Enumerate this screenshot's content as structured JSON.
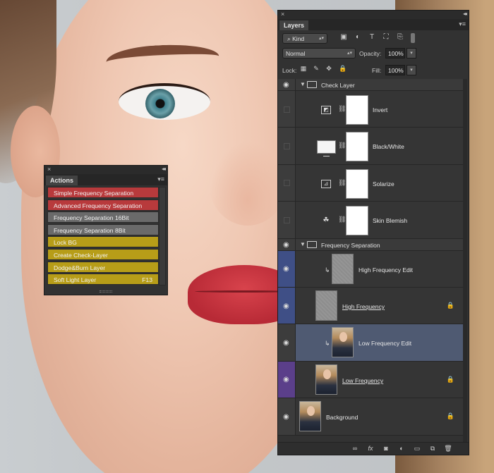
{
  "actions_panel": {
    "close_symbol": "×",
    "collapse_symbol": "◂◂",
    "tab_label": "Actions",
    "menu_symbol": "▾≡",
    "items": [
      {
        "label": "Simple Frequency Separation",
        "color": "#b83a3c",
        "key": ""
      },
      {
        "label": "Advanced Frequency Separation",
        "color": "#b83a3c",
        "key": ""
      },
      {
        "label": "Frequency Separation 16Bit",
        "color": "#6a6a6a",
        "key": ""
      },
      {
        "label": "Frequency Separation 8Bit",
        "color": "#6a6a6a",
        "key": ""
      },
      {
        "label": "Lock BG",
        "color": "#b79d18",
        "key": ""
      },
      {
        "label": "Create Check-Layer",
        "color": "#b79d18",
        "key": ""
      },
      {
        "label": "Dodge&Burn Layer",
        "color": "#b79d18",
        "key": ""
      },
      {
        "label": "Soft Light Layer",
        "color": "#b79d18",
        "key": "F13"
      }
    ]
  },
  "layers_panel": {
    "close_symbol": "×",
    "collapse_symbol": "◂◂",
    "tab_label": "Layers",
    "menu_symbol": "▾≡",
    "filter": {
      "kind_label": "Kind",
      "search_glyph": "⌕"
    },
    "blend_mode": "Normal",
    "opacity_label": "Opacity:",
    "opacity_value": "100%",
    "lock_label": "Lock:",
    "fill_label": "Fill:",
    "fill_value": "100%",
    "layers": [
      {
        "id": "check-layer",
        "type": "group",
        "name": "Check Layer",
        "visible": true
      },
      {
        "id": "invert",
        "type": "adjustment",
        "name": "Invert",
        "visible": false,
        "icon": "invert-icon",
        "glyph": "◩"
      },
      {
        "id": "black-white",
        "type": "adjustment-wide",
        "name": "Black/White",
        "visible": false,
        "icon": "black-white-icon"
      },
      {
        "id": "solarize",
        "type": "adjustment",
        "name": "Solarize",
        "visible": false,
        "icon": "curves-icon",
        "glyph": "⊿"
      },
      {
        "id": "skin-blemish",
        "type": "adjustment",
        "name": "Skin Blemish",
        "visible": false,
        "icon": "selective-color-icon",
        "glyph": "☘"
      },
      {
        "id": "frequency-separation",
        "type": "group",
        "name": "Frequency Separation",
        "visible": true
      },
      {
        "id": "high-frequency-edit",
        "type": "clipped-gray",
        "name": "High Frequency Edit",
        "visible": true,
        "vis_color": "blue"
      },
      {
        "id": "high-frequency",
        "type": "gray",
        "name": "High Frequency",
        "visible": true,
        "vis_color": "blue",
        "locked": true
      },
      {
        "id": "low-frequency-edit",
        "type": "clipped-photo",
        "name": "Low Frequency Edit",
        "visible": true,
        "selected": true
      },
      {
        "id": "low-frequency",
        "type": "photo",
        "name": "Low Frequency",
        "visible": true,
        "vis_color": "purple",
        "locked": true
      },
      {
        "id": "background",
        "type": "photo-bg",
        "name": "Background",
        "visible": true,
        "locked": true
      }
    ]
  },
  "colors": {
    "panel_bg": "#323232",
    "selected_layer": "#4f5a72",
    "vis_blue": "#3f4f86",
    "vis_purple": "#5b3f8a"
  }
}
